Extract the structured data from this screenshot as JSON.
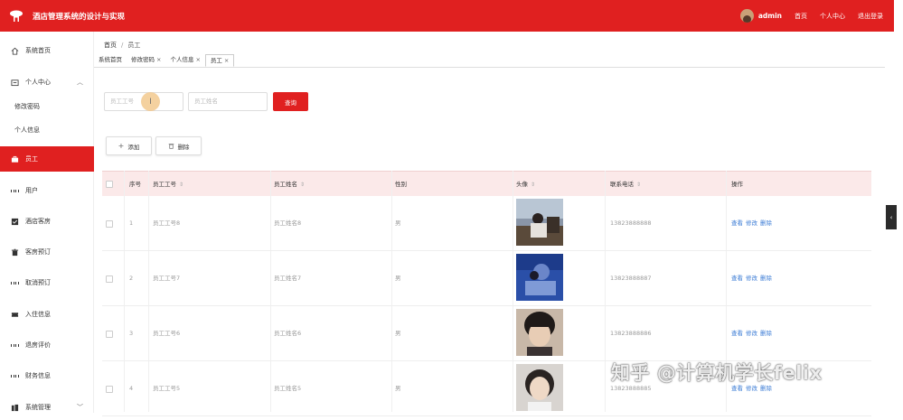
{
  "header": {
    "title": "酒店管理系统的设计与实现",
    "user": "admin",
    "links": [
      "首页",
      "个人中心",
      "退出登录"
    ],
    "color": "#e02020"
  },
  "sidebar": {
    "items": [
      {
        "label": "系统首页",
        "icon": "home-icon"
      },
      {
        "label": "个人中心",
        "icon": "profile-icon"
      },
      {
        "label": "修改密码",
        "icon": ""
      },
      {
        "label": "个人信息",
        "icon": ""
      },
      {
        "label": "员工",
        "icon": "briefcase-icon"
      },
      {
        "label": "用户",
        "icon": "grid-icon"
      },
      {
        "label": "酒店客房",
        "icon": "checkbox-icon"
      },
      {
        "label": "客房预订",
        "icon": "trash-icon"
      },
      {
        "label": "取消预订",
        "icon": "grid-icon"
      },
      {
        "label": "入住信息",
        "icon": "ticket-icon"
      },
      {
        "label": "退房评价",
        "icon": "grid-icon"
      },
      {
        "label": "财务信息",
        "icon": "grid-icon"
      },
      {
        "label": "系统管理",
        "icon": "building-icon"
      }
    ]
  },
  "breadcrumb": [
    "首页",
    "员工"
  ],
  "tabs": [
    {
      "label": "系统首页",
      "closable": false
    },
    {
      "label": "修改密码",
      "closable": true
    },
    {
      "label": "个人信息",
      "closable": true
    },
    {
      "label": "员工",
      "closable": true
    }
  ],
  "search": {
    "id_placeholder": "员工工号",
    "name_placeholder": "员工姓名",
    "button": "查询"
  },
  "actions": {
    "add": "添加",
    "delete": "删除"
  },
  "table": {
    "columns": [
      "序号",
      "员工工号",
      "员工姓名",
      "性别",
      "头像",
      "联系电话",
      "操作"
    ],
    "rows": [
      {
        "index": "1",
        "id": "员工工号8",
        "name": "员工姓名8",
        "gender": "男",
        "phone": "13823888888"
      },
      {
        "index": "2",
        "id": "员工工号7",
        "name": "员工姓名7",
        "gender": "男",
        "phone": "13823888887"
      },
      {
        "index": "3",
        "id": "员工工号6",
        "name": "员工姓名6",
        "gender": "男",
        "phone": "13823888886"
      },
      {
        "index": "4",
        "id": "员工工号5",
        "name": "员工姓名5",
        "gender": "男",
        "phone": "13823888885"
      }
    ],
    "ops": [
      "查看",
      "修改",
      "删除"
    ]
  },
  "watermark": "知乎 @计算机学长felix"
}
